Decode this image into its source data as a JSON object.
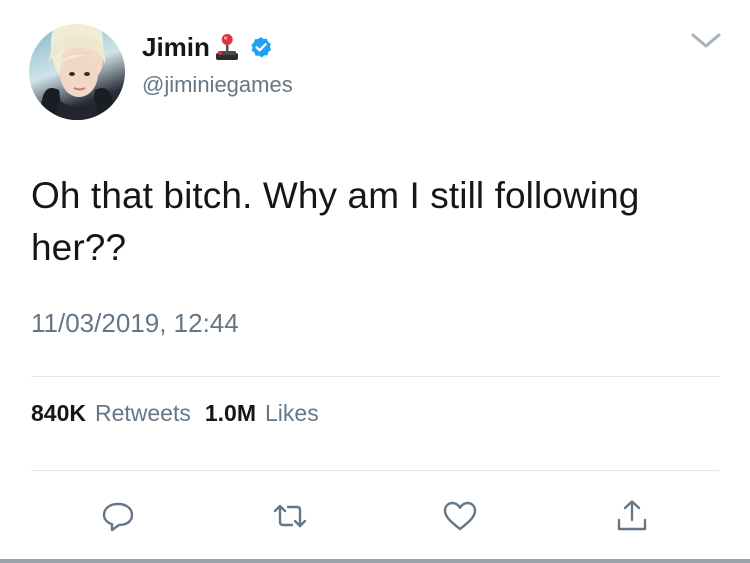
{
  "user": {
    "display_name": "Jimin",
    "handle": "@jiminiegames",
    "verified": true,
    "name_emoji": "joystick-icon"
  },
  "tweet": {
    "text": "Oh that bitch. Why am I still following her??",
    "timestamp": "11/03/2019, 12:44"
  },
  "stats": {
    "retweets_count": "840K",
    "retweets_label": "Retweets",
    "likes_count": "1.0M",
    "likes_label": "Likes"
  },
  "actions": [
    "reply-icon",
    "retweet-icon",
    "like-icon",
    "share-icon"
  ],
  "colors": {
    "text": "#14171a",
    "secondary": "#657786",
    "verified_blue": "#1da1f2",
    "divider": "#e1e8ed"
  }
}
